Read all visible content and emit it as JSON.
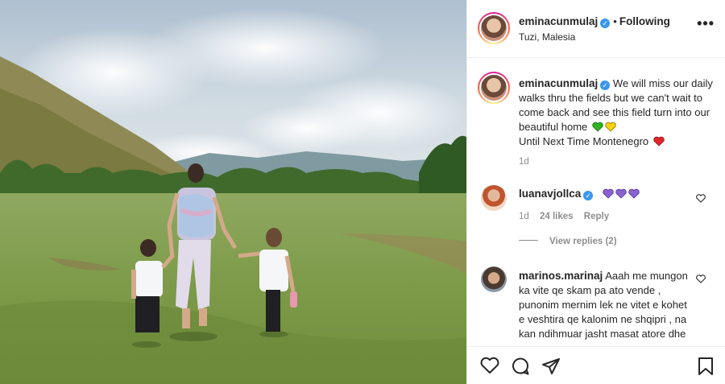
{
  "header": {
    "username": "eminacunmulaj",
    "dot": "•",
    "follow_status": "Following",
    "location": "Tuzi, Malesia",
    "more_label": "•••"
  },
  "caption": {
    "username": "eminacunmulaj",
    "text_line1": "We will miss our daily walks thru the fields but we can't wait to come back and see this field turn into our beautiful home",
    "text_line2": "Until Next Time Montenegro",
    "age": "1d",
    "emoji": [
      "green-heart",
      "yellow-heart",
      "red-heart"
    ]
  },
  "comments": [
    {
      "username": "luanavjollca",
      "verified": true,
      "emoji": [
        "purple-heart",
        "purple-heart",
        "purple-heart"
      ],
      "age": "1d",
      "likes": "24 likes",
      "reply": "Reply",
      "view_replies": "View replies (2)"
    },
    {
      "username": "marinos.marinaj",
      "verified": false,
      "text": "Aaah me mungon ka vite qe skam pa ato vende , punonim mernim lek ne vitet e kohet e veshtira qe kalonim ne shqipri , na kan ndihmuar jasht masat atore dhe"
    }
  ],
  "colors": {
    "verified": "#3897f0",
    "muted": "#8e8e8e",
    "text": "#262626",
    "green_heart": "#2fb31f",
    "yellow_heart": "#f5d20f",
    "red_heart": "#e0262b",
    "purple_heart": "#8a63d2"
  },
  "icons": [
    "heart-icon",
    "comment-icon",
    "share-icon",
    "save-icon",
    "more-icon",
    "verified-icon"
  ]
}
